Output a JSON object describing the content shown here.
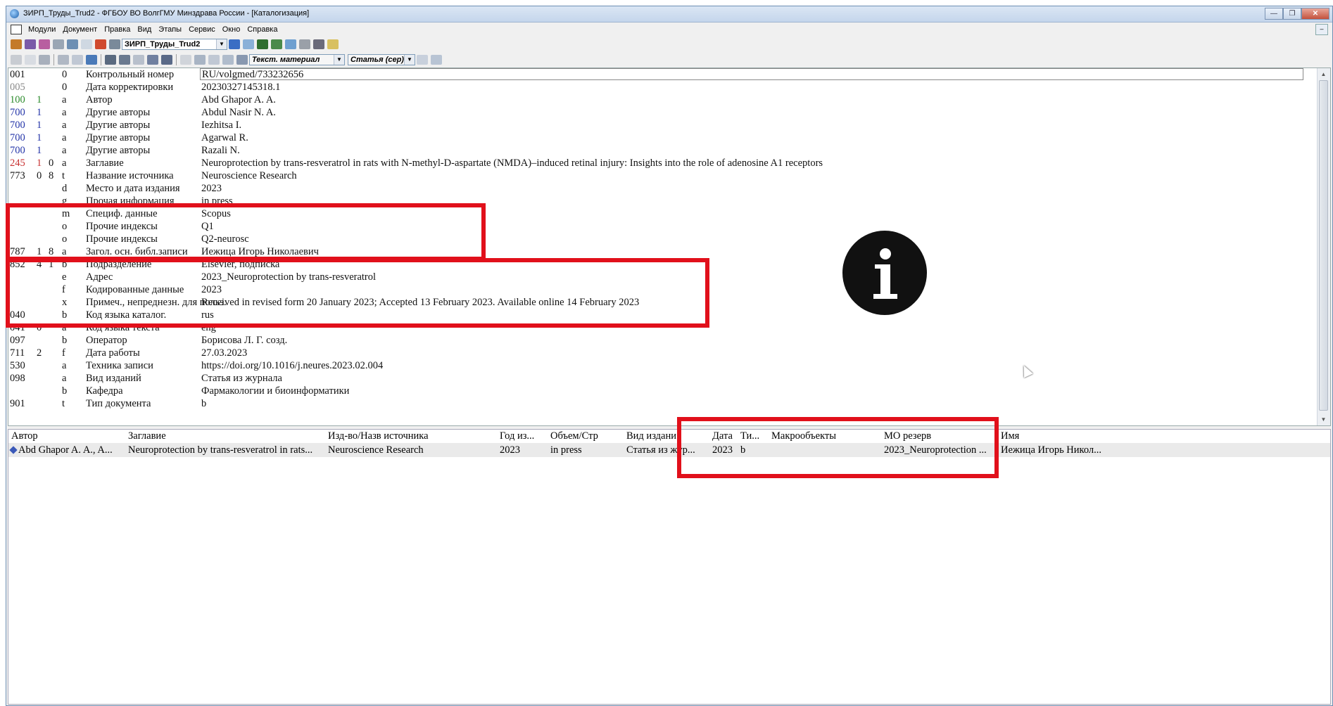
{
  "window": {
    "title": "ЗИРП_Труды_Trud2 - ФГБОУ ВО ВолгГМУ Минздрава России - [Каталогизация]"
  },
  "menu": [
    "Модули",
    "Документ",
    "Правка",
    "Вид",
    "Этапы",
    "Сервис",
    "Окно",
    "Справка"
  ],
  "toolbar": {
    "database_combo": "ЗИРП_Труды_Trud2",
    "material_combo": "Текст. материал",
    "type_combo": "Статья (сер)"
  },
  "record": [
    {
      "tag": "001",
      "i1": "",
      "i2": "",
      "sub": "0",
      "label": "Контрольный номер",
      "value": "RU/volgmed/733232656"
    },
    {
      "tag": "005",
      "i1": "",
      "i2": "",
      "sub": "0",
      "label": "Дата корректировки",
      "value": "20230327145318.1"
    },
    {
      "tag": "100",
      "i1": "1",
      "i2": "",
      "sub": "a",
      "label": "Автор",
      "value": "Abd Ghapor A. A."
    },
    {
      "tag": "700",
      "i1": "1",
      "i2": "",
      "sub": "a",
      "label": "Другие авторы",
      "value": "Abdul Nasir N. A."
    },
    {
      "tag": "700",
      "i1": "1",
      "i2": "",
      "sub": "a",
      "label": "Другие авторы",
      "value": "Iezhitsa I."
    },
    {
      "tag": "700",
      "i1": "1",
      "i2": "",
      "sub": "a",
      "label": "Другие авторы",
      "value": "Agarwal R."
    },
    {
      "tag": "700",
      "i1": "1",
      "i2": "",
      "sub": "a",
      "label": "Другие авторы",
      "value": "Razali N."
    },
    {
      "tag": "245",
      "i1": "1",
      "i2": "0",
      "sub": "a",
      "label": "Заглавие",
      "value": "Neuroprotection by trans-resveratrol in rats with N-methyl-D-aspartate (NMDA)–induced retinal injury: Insights into the role of adenosine A1 receptors"
    },
    {
      "tag": "773",
      "i1": "0",
      "i2": "8",
      "sub": "t",
      "label": "Название источника",
      "value": "Neuroscience Research"
    },
    {
      "tag": "",
      "i1": "",
      "i2": "",
      "sub": "d",
      "label": "Место и дата издания",
      "value": "2023"
    },
    {
      "tag": "",
      "i1": "",
      "i2": "",
      "sub": "g",
      "label": "Прочая информация",
      "value": "in press"
    },
    {
      "tag": "",
      "i1": "",
      "i2": "",
      "sub": "m",
      "label": "Специф. данные",
      "value": "Scopus"
    },
    {
      "tag": "",
      "i1": "",
      "i2": "",
      "sub": "o",
      "label": "Прочие индексы",
      "value": "Q1"
    },
    {
      "tag": "",
      "i1": "",
      "i2": "",
      "sub": "o",
      "label": "Прочие индексы",
      "value": "Q2-neurosc"
    },
    {
      "tag": "787",
      "i1": "1",
      "i2": "8",
      "sub": "a",
      "label": "Загол. осн. библ.записи",
      "value": "Иежица Игорь Николаевич"
    },
    {
      "tag": "852",
      "i1": "4",
      "i2": "1",
      "sub": "b",
      "label": "Подразделение",
      "value": "Elsevier, подписка"
    },
    {
      "tag": "",
      "i1": "",
      "i2": "",
      "sub": "e",
      "label": "Адрес",
      "value": "2023_Neuroprotection by trans-resveratrol"
    },
    {
      "tag": "",
      "i1": "",
      "i2": "",
      "sub": "f",
      "label": "Кодированные данные",
      "value": "2023"
    },
    {
      "tag": "",
      "i1": "",
      "i2": "",
      "sub": "x",
      "label": "Примеч., непреднезн. для польз.",
      "value": "Received in revised form 20 January 2023; Accepted 13 February 2023. Available online 14 February 2023"
    },
    {
      "tag": "040",
      "i1": "",
      "i2": "",
      "sub": "b",
      "label": "Код языка каталог.",
      "value": "rus"
    },
    {
      "tag": "041",
      "i1": "0",
      "i2": "",
      "sub": "a",
      "label": "Код языка текста",
      "value": "eng"
    },
    {
      "tag": "097",
      "i1": "",
      "i2": "",
      "sub": "b",
      "label": "Оператор",
      "value": "Борисова Л. Г. созд."
    },
    {
      "tag": "711",
      "i1": "2",
      "i2": "",
      "sub": "f",
      "label": "Дата работы",
      "value": "27.03.2023"
    },
    {
      "tag": "530",
      "i1": "",
      "i2": "",
      "sub": "a",
      "label": "Техника записи",
      "value": "https://doi.org/10.1016/j.neures.2023.02.004"
    },
    {
      "tag": "098",
      "i1": "",
      "i2": "",
      "sub": "a",
      "label": "Вид изданий",
      "value": "Статья из журнала"
    },
    {
      "tag": "",
      "i1": "",
      "i2": "",
      "sub": "b",
      "label": "Кафедра",
      "value": "Фармакологии и биоинформатики"
    },
    {
      "tag": "901",
      "i1": "",
      "i2": "",
      "sub": "t",
      "label": "Тип документа",
      "value": "b"
    }
  ],
  "grid": {
    "headers": {
      "author": "Автор",
      "title": "Заглавие",
      "publisher": "Изд-во/Назв источника",
      "year": "Год из...",
      "volume": "Объем/Стр",
      "kind": "Вид издани",
      "date": "Дата",
      "type": "Ти...",
      "macro": "Макрообъекты",
      "mo_reserve": "МО резерв",
      "name": "Имя"
    },
    "row": {
      "author": "Abd Ghapor A. A., A...",
      "title": "Neuroprotection by trans-resveratrol in rats...",
      "publisher": "Neuroscience Research",
      "year": "2023",
      "volume": "in press",
      "kind": "Статья из жур...",
      "date": "2023",
      "type": "b",
      "macro": "",
      "mo_reserve": "2023_Neuroprotection ...",
      "name": "Иежица Игорь Никол..."
    }
  },
  "colors": {
    "annotation_box": "#e1101b",
    "tag_gray": "#8a8a8a",
    "tag_green": "#2a8a2a",
    "tag_blue": "#2233a8",
    "tag_red": "#c83232"
  }
}
